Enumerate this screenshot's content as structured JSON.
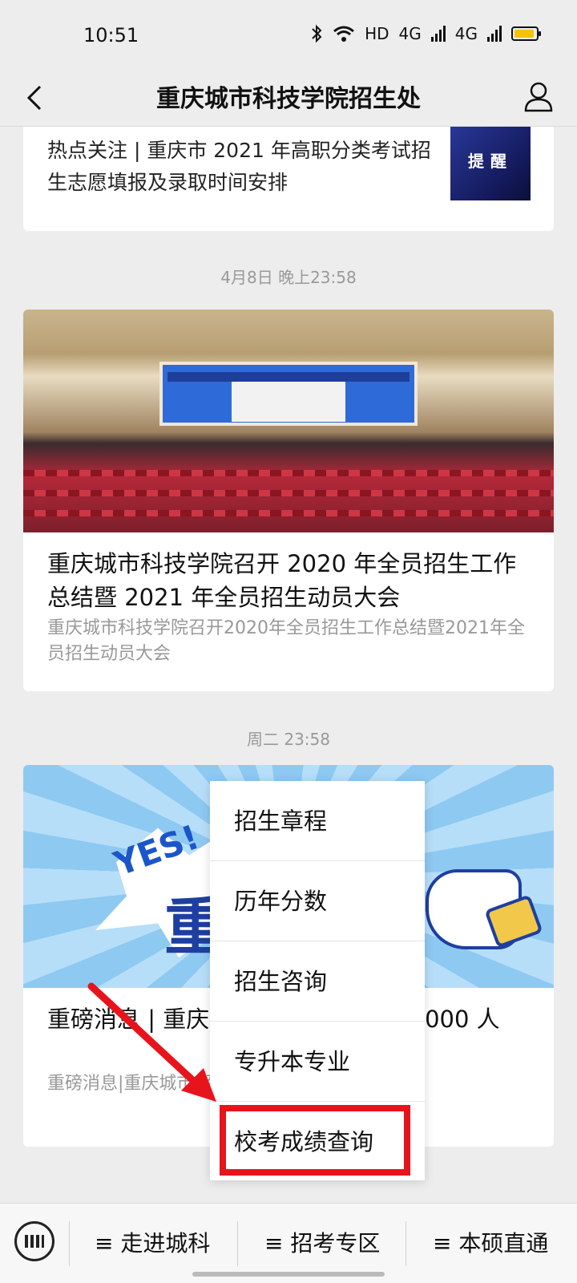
{
  "status_bar": {
    "time": "10:51",
    "network_hd": "HD",
    "signal_1": "4G",
    "signal_2": "4G"
  },
  "nav": {
    "title": "重庆城市科技学院招生处"
  },
  "feed": {
    "article_top": {
      "text": "热点关注 | 重庆市 2021 年高职分类考试招生志愿填报及录取时间安排",
      "thumb_label": "提醒"
    },
    "timestamp_1": "4月8日 晚上23:58",
    "article_2": {
      "title": "重庆城市科技学院召开 2020 年全员招生工作总结暨 2021 年全员招生动员大会",
      "desc": "重庆城市科技学院召开2020年全员招生工作总结暨2021年全员招生动员大会"
    },
    "timestamp_2": "周二 23:58",
    "article_3": {
      "title": "重磅消息 | 重庆                           年专升本招生计划 3000 人",
      "desc": "重磅消息|重庆城市                                招生计划3000人",
      "image_text_yes": "YES!",
      "image_text_zhong": "重"
    }
  },
  "popup_menu": {
    "items": [
      "招生章程",
      "历年分数",
      "招生咨询",
      "专升本专业",
      "校考成绩查询"
    ]
  },
  "bottom_menu": {
    "items": [
      "≡ 走进城科",
      "≡ 招考专区",
      "≡ 本硕直通"
    ]
  },
  "colors": {
    "highlight": "#e8141c",
    "battery": "#f5c400"
  }
}
